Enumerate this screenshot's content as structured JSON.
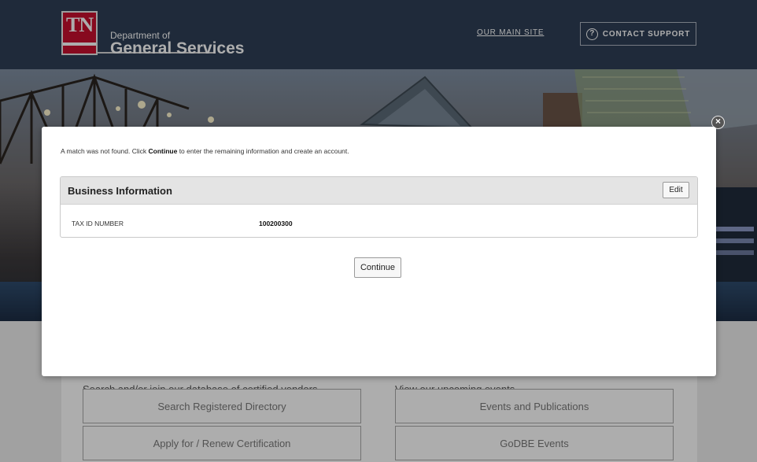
{
  "header": {
    "logo_text": "TN",
    "department_line1": "Department of",
    "department_line2": "General Services",
    "main_site_link": "OUR MAIN SITE",
    "contact_support_label": "CONTACT SUPPORT",
    "contact_icon": "help-circle-icon"
  },
  "main": {
    "left_column_description": "Search and/or join our database of certified vendors",
    "right_column_description": "View our upcoming events",
    "buttons": {
      "search_directory": "Search Registered Directory",
      "apply_certification": "Apply for / Renew Certification",
      "events_publications": "Events and Publications",
      "godbe_events": "GoDBE Events"
    }
  },
  "modal": {
    "close_icon": "close-circle-icon",
    "message_before": "A match was not found. Click ",
    "message_bold": "Continue",
    "message_after": " to enter the remaining information and create an account.",
    "panel_title": "Business Information",
    "edit_label": "Edit",
    "fields": [
      {
        "label": "TAX ID NUMBER",
        "value": "100200300"
      }
    ],
    "continue_label": "Continue"
  },
  "colors": {
    "header_bg": "#2e3f56",
    "logo_red": "#c8102e",
    "panel_header_bg": "#e4e4e4",
    "lower_bg": "#eeeeee"
  }
}
